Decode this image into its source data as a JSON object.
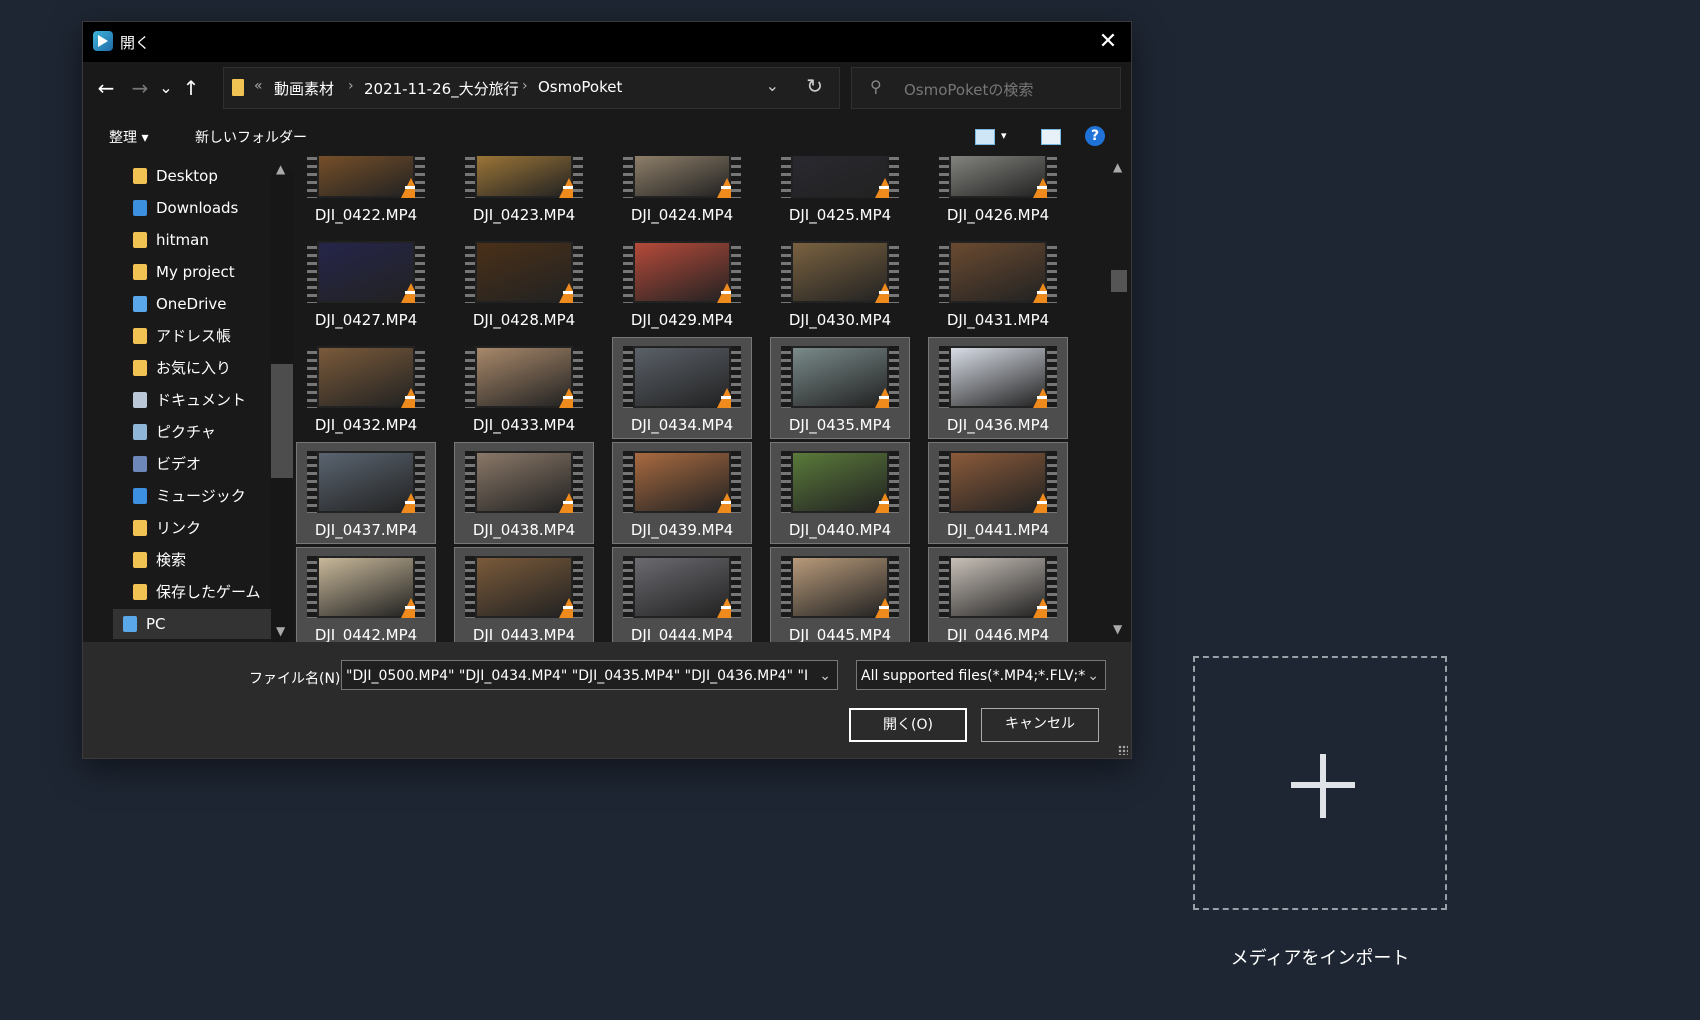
{
  "dialog": {
    "title": "開く",
    "close_glyph": "✕",
    "nav": {
      "back": "←",
      "forward": "→",
      "recent": "⌄",
      "up": "↑"
    },
    "address": {
      "crumbs": [
        "動画素材",
        "2021-11-26_大分旅行",
        "OsmoPoket"
      ],
      "overflow": "«",
      "separator": "›",
      "dropdown": "⌄",
      "refresh": "↻"
    },
    "search": {
      "placeholder": "OsmoPoketの検索",
      "icon": "⚲"
    },
    "toolbar": {
      "organize": "整理 ▾",
      "new_folder": "新しいフォルダー",
      "view_dd": "▾",
      "help": "?"
    },
    "nav_pane": [
      {
        "label": "Desktop",
        "icon": "folder-icon",
        "color": "#f0c254"
      },
      {
        "label": "Downloads",
        "icon": "download-icon",
        "color": "#3d8fe0"
      },
      {
        "label": "hitman",
        "icon": "folder-icon",
        "color": "#f0c254"
      },
      {
        "label": "My project",
        "icon": "folder-icon",
        "color": "#f0c254"
      },
      {
        "label": "OneDrive",
        "icon": "onedrive-folder-icon",
        "color": "#5aa7ea"
      },
      {
        "label": "アドレス帳",
        "icon": "contacts-folder-icon",
        "color": "#f0c254"
      },
      {
        "label": "お気に入り",
        "icon": "favorites-folder-icon",
        "color": "#f0c254"
      },
      {
        "label": "ドキュメント",
        "icon": "documents-icon",
        "color": "#b9c7d6"
      },
      {
        "label": "ピクチャ",
        "icon": "pictures-icon",
        "color": "#8fb6d6"
      },
      {
        "label": "ビデオ",
        "icon": "videos-icon",
        "color": "#6c87b8"
      },
      {
        "label": "ミュージック",
        "icon": "music-icon",
        "color": "#3d8fe0"
      },
      {
        "label": "リンク",
        "icon": "links-folder-icon",
        "color": "#f0c254"
      },
      {
        "label": "検索",
        "icon": "search-folder-icon",
        "color": "#f0c254"
      },
      {
        "label": "保存したゲーム",
        "icon": "saved-games-icon",
        "color": "#f0c254"
      },
      {
        "label": "PC",
        "icon": "pc-icon",
        "color": "#5aa7ea"
      }
    ],
    "files": [
      {
        "name": "DJI_0422.MP4",
        "selected": false,
        "color": "#8a5a2a"
      },
      {
        "name": "DJI_0423.MP4",
        "selected": false,
        "color": "#b8893c"
      },
      {
        "name": "DJI_0424.MP4",
        "selected": false,
        "color": "#a8957a"
      },
      {
        "name": "DJI_0425.MP4",
        "selected": false,
        "color": "#2a2a33"
      },
      {
        "name": "DJI_0426.MP4",
        "selected": false,
        "color": "#9a9a94"
      },
      {
        "name": "DJI_0427.MP4",
        "selected": false,
        "color": "#24254a"
      },
      {
        "name": "DJI_0428.MP4",
        "selected": false,
        "color": "#4a3018"
      },
      {
        "name": "DJI_0429.MP4",
        "selected": false,
        "color": "#b54a3a"
      },
      {
        "name": "DJI_0430.MP4",
        "selected": false,
        "color": "#7a6240"
      },
      {
        "name": "DJI_0431.MP4",
        "selected": false,
        "color": "#6a4a30"
      },
      {
        "name": "DJI_0432.MP4",
        "selected": false,
        "color": "#7a5a3a"
      },
      {
        "name": "DJI_0433.MP4",
        "selected": false,
        "color": "#a8886a"
      },
      {
        "name": "DJI_0434.MP4",
        "selected": true,
        "color": "#5a6068"
      },
      {
        "name": "DJI_0435.MP4",
        "selected": true,
        "color": "#7a8a8a"
      },
      {
        "name": "DJI_0436.MP4",
        "selected": true,
        "color": "#d8dde6"
      },
      {
        "name": "DJI_0437.MP4",
        "selected": true,
        "color": "#5a6470"
      },
      {
        "name": "DJI_0438.MP4",
        "selected": true,
        "color": "#8a7868"
      },
      {
        "name": "DJI_0439.MP4",
        "selected": true,
        "color": "#a86a40"
      },
      {
        "name": "DJI_0440.MP4",
        "selected": true,
        "color": "#5a7a3a"
      },
      {
        "name": "DJI_0441.MP4",
        "selected": true,
        "color": "#8a5a3a"
      },
      {
        "name": "DJI_0442.MP4",
        "selected": true,
        "color": "#c8b89a"
      },
      {
        "name": "DJI_0443.MP4",
        "selected": true,
        "color": "#7a5a3a"
      },
      {
        "name": "DJI_0444.MP4",
        "selected": true,
        "color": "#6a6a70"
      },
      {
        "name": "DJI_0445.MP4",
        "selected": true,
        "color": "#b89a7a"
      },
      {
        "name": "DJI_0446.MP4",
        "selected": true,
        "color": "#c8c0b8"
      }
    ],
    "filename_label": "ファイル名(N):",
    "filename_value": "\"DJI_0500.MP4\" \"DJI_0434.MP4\" \"DJI_0435.MP4\" \"DJI_0436.MP4\" \"I",
    "filter_value": "All supported files(*.MP4;*.FLV;*",
    "dropdown_glyph": "⌄",
    "open_button": "開く(O)",
    "cancel_button": "キャンセル"
  },
  "import": {
    "label": "メディアをインポート"
  }
}
